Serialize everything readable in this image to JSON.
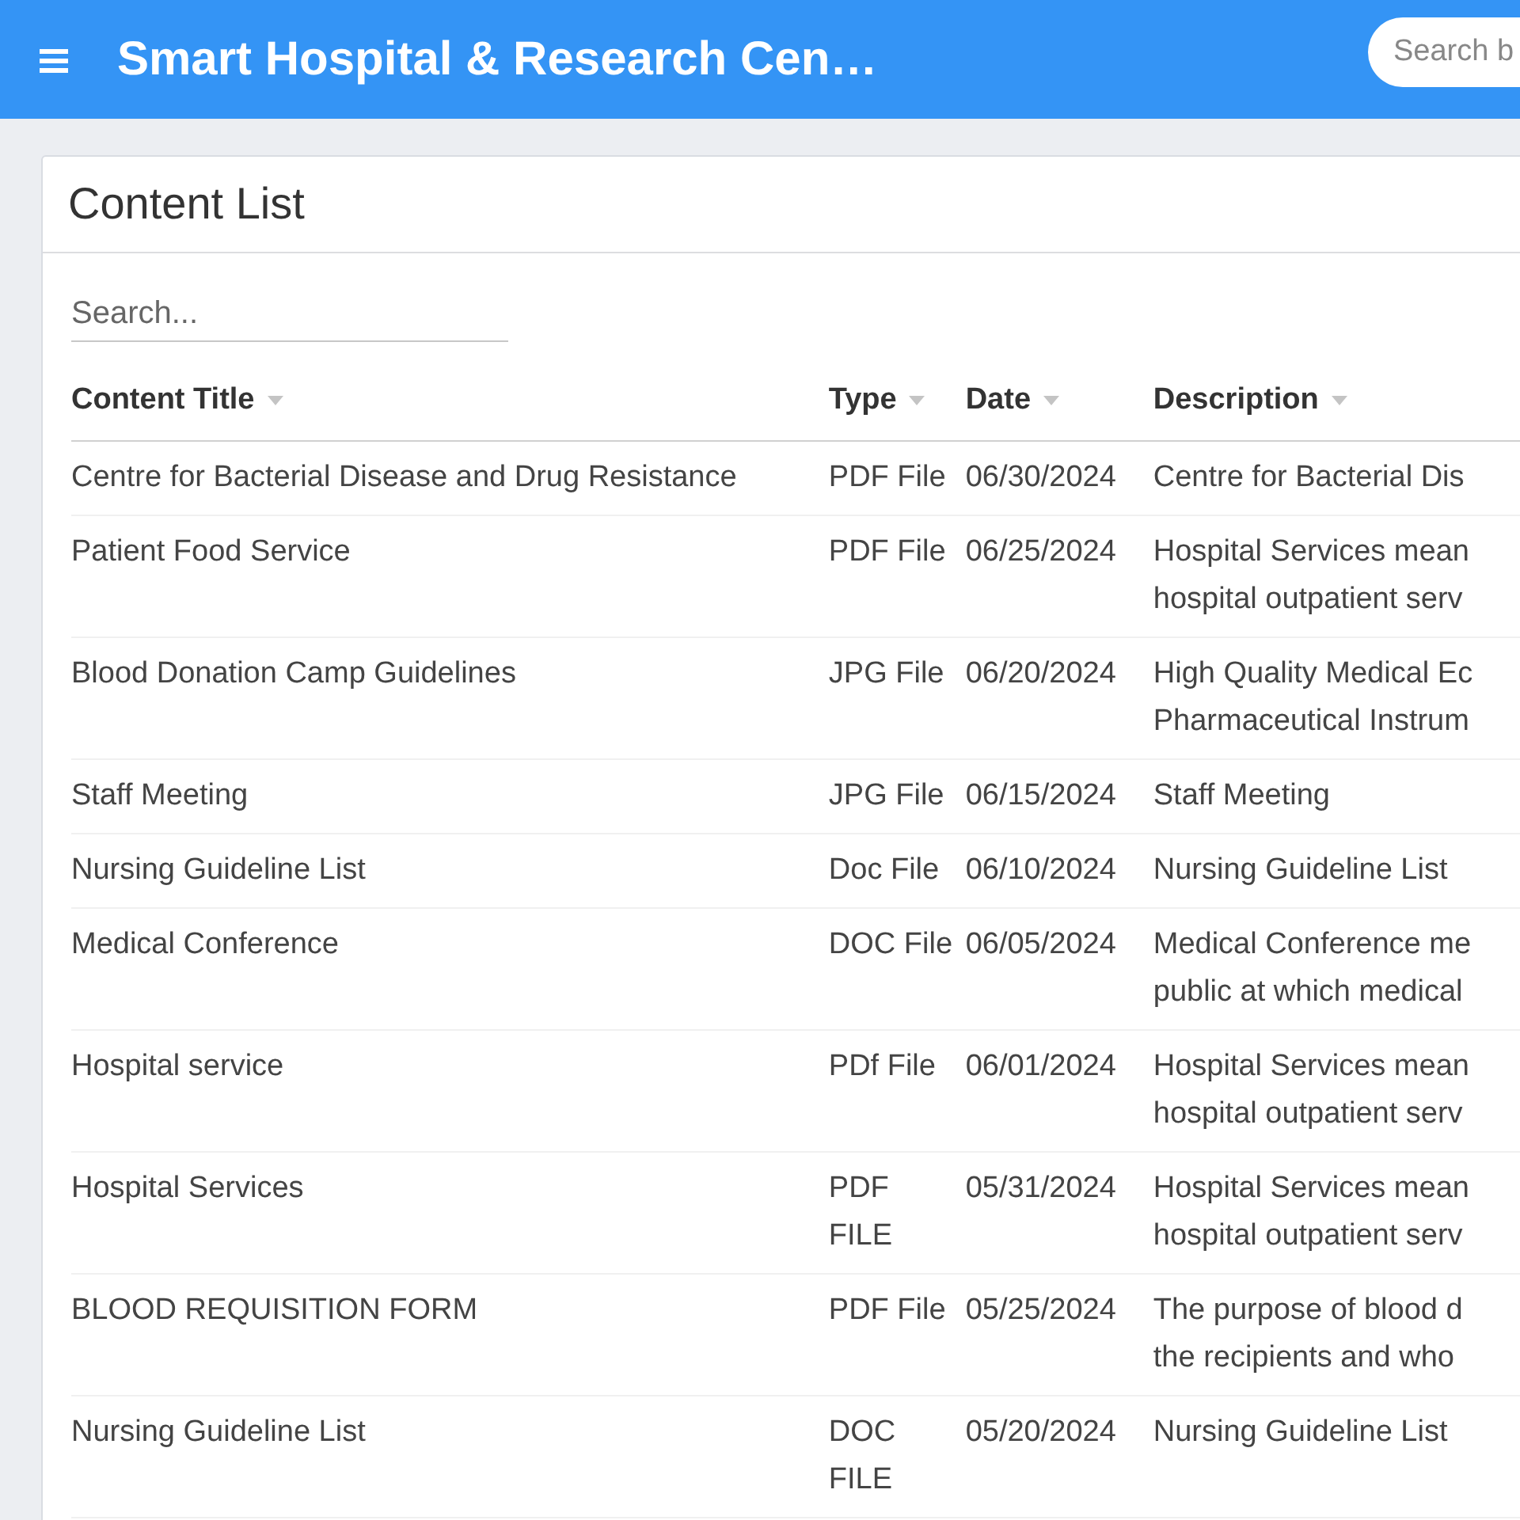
{
  "app_bar": {
    "title": "Smart Hospital & Research Cen…",
    "search": {
      "placeholder": "Search b"
    }
  },
  "card": {
    "title": "Content List",
    "search": {
      "placeholder": "Search..."
    }
  },
  "table": {
    "columns": [
      "Content Title",
      "Type",
      "Date",
      "Description"
    ],
    "rows": [
      {
        "title": "Centre for Bacterial Disease and Drug Resistance",
        "type": "PDF File",
        "date": "06/30/2024",
        "description": "Centre for Bacterial Dis"
      },
      {
        "title": "Patient Food Service",
        "type": "PDF File",
        "date": "06/25/2024",
        "description": "Hospital Services mean\nhospital outpatient serv"
      },
      {
        "title": "Blood Donation Camp Guidelines",
        "type": "JPG File",
        "date": "06/20/2024",
        "description": "High Quality Medical Ec\nPharmaceutical Instrum"
      },
      {
        "title": "Staff Meeting",
        "type": "JPG File",
        "date": "06/15/2024",
        "description": "Staff Meeting"
      },
      {
        "title": "Nursing Guideline List",
        "type": "Doc File",
        "date": "06/10/2024",
        "description": "Nursing Guideline List"
      },
      {
        "title": "Medical Conference",
        "type": "DOC File",
        "date": "06/05/2024",
        "description": "Medical Conference me\npublic at which medical"
      },
      {
        "title": "Hospital service",
        "type": "PDf File",
        "date": "06/01/2024",
        "description": "Hospital Services mean\nhospital outpatient serv"
      },
      {
        "title": "Hospital Services",
        "type": "PDF FILE",
        "date": "05/31/2024",
        "description": "Hospital Services mean\nhospital outpatient serv"
      },
      {
        "title": "BLOOD REQUISITION FORM",
        "type": "PDF File",
        "date": "05/25/2024",
        "description": "The purpose of blood d\nthe recipients and who"
      },
      {
        "title": "Nursing Guideline List",
        "type": "DOC FILE",
        "date": "05/20/2024",
        "description": "Nursing Guideline List"
      }
    ]
  }
}
